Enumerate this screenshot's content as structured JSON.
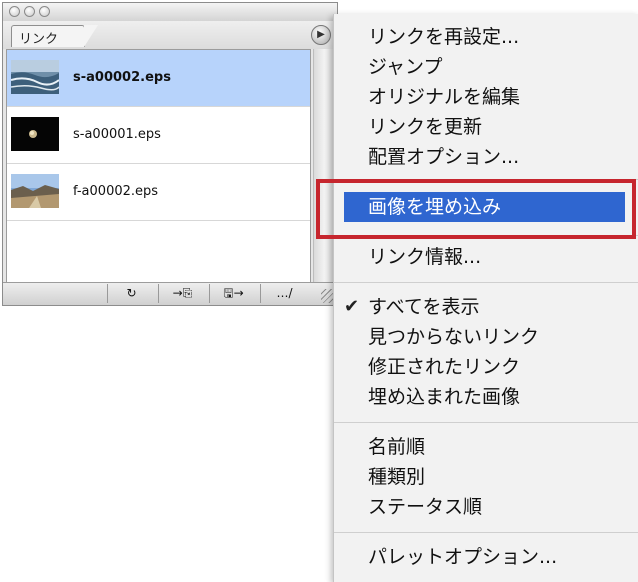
{
  "panel": {
    "tab_label": "リンク",
    "menu_arrow_icon": "triangle-right-icon",
    "files": [
      {
        "name": "s-a00002.eps",
        "selected": true
      },
      {
        "name": "s-a00001.eps",
        "selected": false
      },
      {
        "name": "f-a00002.eps",
        "selected": false
      }
    ],
    "bottom_buttons": [
      {
        "icon": "relink-icon",
        "label": "↻"
      },
      {
        "icon": "goto-link-icon",
        "label": "→⎘"
      },
      {
        "icon": "update-link-icon",
        "label": "🖫→"
      },
      {
        "icon": "edit-original-icon",
        "label": "…/"
      }
    ]
  },
  "menu": {
    "items": [
      "リンクを再設定...",
      "ジャンプ",
      "オリジナルを編集",
      "リンクを更新",
      "配置オプション...",
      "画像を埋め込み",
      "リンク情報...",
      "すべてを表示",
      "見つからないリンク",
      "修正されたリンク",
      "埋め込まれた画像",
      "名前順",
      "種類別",
      "ステータス順",
      "パレットオプション..."
    ],
    "highlighted_index": 5,
    "checked_index": 7,
    "check_mark": "✔"
  },
  "colors": {
    "highlight": "#2f66d0",
    "selection_row": "#b7d3fb",
    "callout_border": "#c6262e"
  }
}
